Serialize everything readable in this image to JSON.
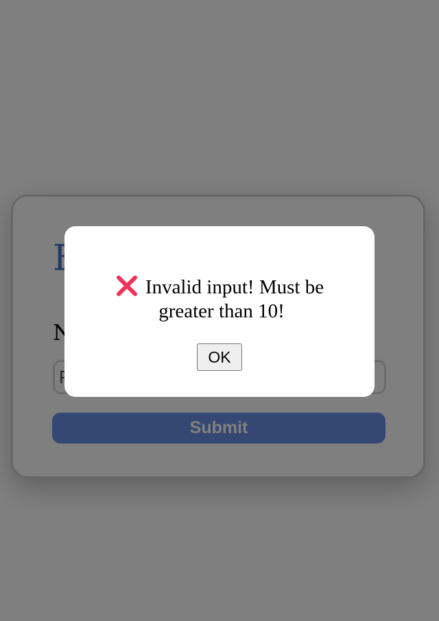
{
  "form": {
    "title": "F",
    "field_label": "N",
    "input_placeholder": "P",
    "submit_label": "Submit"
  },
  "dialog": {
    "icon": "red-x-icon",
    "message_line1": "Invalid input! Must be",
    "message_line2": "greater than 10!",
    "ok_label": "OK"
  },
  "colors": {
    "overlay": "#00000080",
    "title_blue": "#4a74c9",
    "submit_bg": "#6990e6",
    "error_icon": "#f0325a"
  }
}
